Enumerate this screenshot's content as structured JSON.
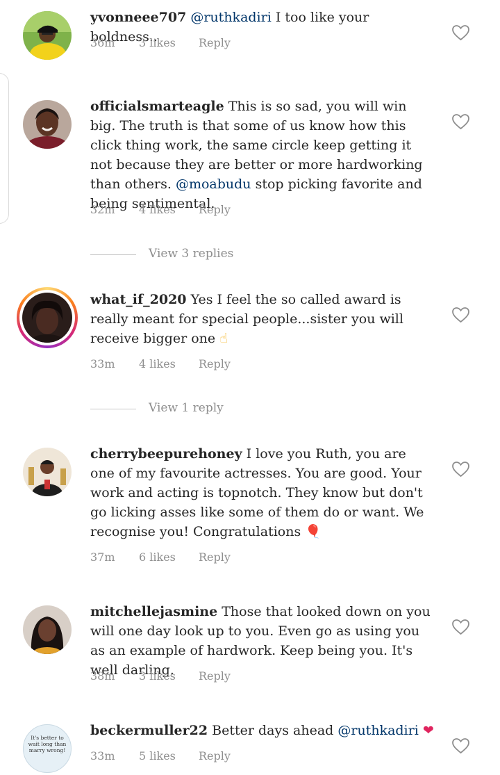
{
  "ui": {
    "accent_mention": "#003569",
    "meta_color": "#8e8e8e",
    "heart_icon": "heart-outline-icon"
  },
  "comments": [
    {
      "username": "yvonneee707",
      "mention": "@ruthkadiri",
      "text": " I too like your boldness..",
      "time": "36m",
      "likes": "3 likes",
      "reply": "Reply"
    },
    {
      "username": "officialsmarteagle",
      "text_before": " This is so sad, you will win big. The truth is that some of us know how this click thing work, the same circle keep getting it  not because they are better or more hardworking than others. ",
      "mention": "@moabudu",
      "text_after": " stop picking favorite and being sentimental.",
      "time": "32m",
      "likes": "4 likes",
      "reply": "Reply",
      "view_replies": "View 3 replies"
    },
    {
      "username": "what_if_2020",
      "text": " Yes I feel the so called award is really meant for special people...sister you will receive bigger one ",
      "emoji": "☝",
      "time": "33m",
      "likes": "4 likes",
      "reply": "Reply",
      "view_replies": "View 1 reply"
    },
    {
      "username": "cherrybeepurehoney",
      "text": " I love you Ruth, you are one of my favourite actresses. You are good. Your work and acting is topnotch. They know but don't go licking asses like some of them do or want. We recognise you! Congratulations ",
      "emoji": "🎈",
      "time": "37m",
      "likes": "6 likes",
      "reply": "Reply"
    },
    {
      "username": "mitchellejasmine",
      "text": " Those that looked down on you will one day look up to you. Even go as using you as an example of hardwork. Keep being you.  It's well darling.",
      "time": "38m",
      "likes": "3 likes",
      "reply": "Reply"
    },
    {
      "username": "beckermuller22",
      "text": " Better days ahead ",
      "mention": "@ruthkadiri",
      "emoji": "❤",
      "avatar_text": "It's better to wait long than marry wrong!",
      "time": "33m",
      "likes": "5 likes",
      "reply": "Reply"
    }
  ]
}
